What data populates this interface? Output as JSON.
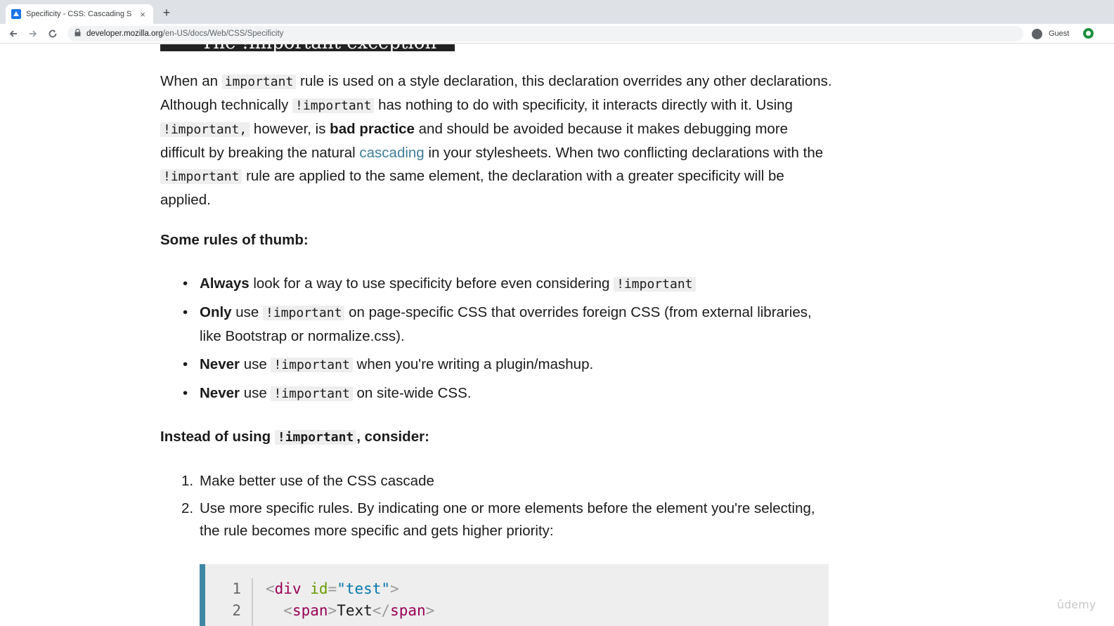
{
  "browser": {
    "tab_title": "Specificity - CSS: Cascading S",
    "tab_close": "×",
    "new_tab": "+",
    "url_host": "developer.mozilla.org",
    "url_path": "/en-US/docs/Web/CSS/Specificity",
    "profile_label": "Guest"
  },
  "section_heading": "The !important exception",
  "paragraph": {
    "t1": "When an ",
    "c1": "important",
    "t2": " rule is used on a style declaration, this declaration overrides any other declarations. Although technically ",
    "c2": "!important",
    "t3": " has nothing to do with specificity, it interacts directly with it. Using ",
    "c3": "!important,",
    "t4": " however, is ",
    "b1": "bad practice",
    "t5": " and should be avoided because it makes debugging more difficult by breaking the natural ",
    "link": "cascading",
    "t6": " in your stylesheets. When two conflicting declarations with the ",
    "c4": "!important",
    "t7": " rule are applied to the same element, the declaration with a greater specificity will be applied."
  },
  "rules_heading": "Some rules of thumb:",
  "rules": [
    {
      "bold": "Always",
      "pre": " look for a way to use specificity before even considering ",
      "code": "!important",
      "post": ""
    },
    {
      "bold": "Only",
      "pre": " use ",
      "code": "!important",
      "post": " on page-specific CSS that overrides foreign CSS (from external libraries, like Bootstrap or normalize.css)."
    },
    {
      "bold": "Never",
      "pre": " use ",
      "code": "!important",
      "post": " when you're writing a plugin/mashup."
    },
    {
      "bold": "Never",
      "pre": " use ",
      "code": "!important",
      "post": " on site-wide CSS."
    }
  ],
  "instead_heading": {
    "pre": "Instead of using ",
    "code": "!important",
    "post": ", consider:"
  },
  "steps": [
    {
      "num": "1.",
      "text": "Make better use of the CSS cascade"
    },
    {
      "num": "2.",
      "text": "Use more specific rules. By indicating one or more elements before the element you're selecting, the rule becomes more specific and gets higher priority:"
    }
  ],
  "code_sample": {
    "line_numbers": [
      "1",
      "2"
    ],
    "l1_open": "<",
    "l1_tag": "div",
    "l1_attr": " id",
    "l1_eq": "=",
    "l1_val": "\"test\"",
    "l1_close": ">",
    "l2_indent": "  ",
    "l2_open": "<",
    "l2_tag": "span",
    "l2_close": ">",
    "l2_text": "Text",
    "l2_endopen": "</",
    "l2_endtag": "span",
    "l2_endclose": ">"
  },
  "watermark": "ûdemy"
}
